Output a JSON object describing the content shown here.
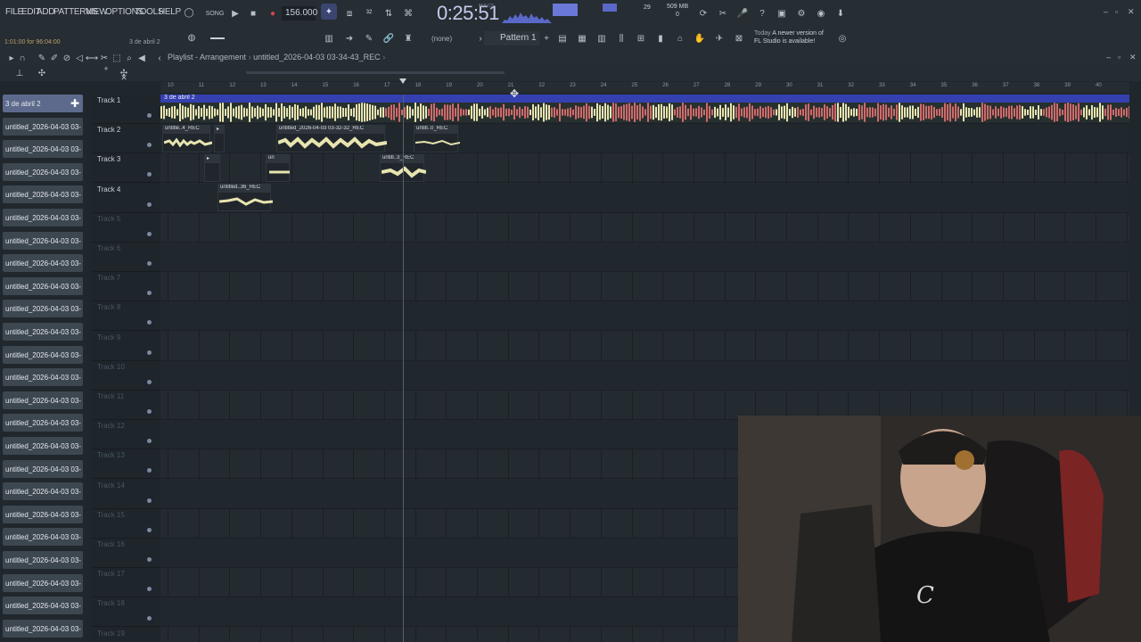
{
  "menu": {
    "items": [
      "FILE",
      "EDIT",
      "ADD",
      "PATTERNS",
      "VIEW",
      "OPTIONS",
      "TOOLS",
      "HELP"
    ]
  },
  "transport": {
    "tempo": "156.000",
    "time": "0:25:51",
    "time_unit": "M:S:CS",
    "cpu_value": "29",
    "memory": "509 MB",
    "memory_sub": "0"
  },
  "hint": {
    "position": "1:01:00 for 96:04:00",
    "track": "3 de abril 2"
  },
  "toolbar": {
    "snap": "(none)",
    "pattern": "Pattern 1"
  },
  "update_notice": {
    "line1_prefix": "Today",
    "line1": "A newer version of",
    "line2": "FL Studio is available!"
  },
  "playlist": {
    "title": "Playlist - Arrangement",
    "breadcrumb": "untitled_2026-04-03 03-34-43_REC"
  },
  "patterns": [
    {
      "label": "3 de abril 2",
      "selected": true
    },
    {
      "label": "untitled_2026-04-03 03-"
    },
    {
      "label": "untitled_2026-04-03 03-"
    },
    {
      "label": "untitled_2026-04-03 03-"
    },
    {
      "label": "untitled_2026-04-03 03-"
    },
    {
      "label": "untitled_2026-04-03 03-"
    },
    {
      "label": "untitled_2026-04-03 03-"
    },
    {
      "label": "untitled_2026-04-03 03-"
    },
    {
      "label": "untitled_2026-04-03 03-"
    },
    {
      "label": "untitled_2026-04-03 03-"
    },
    {
      "label": "untitled_2026-04-03 03-"
    },
    {
      "label": "untitled_2026-04-03 03-"
    },
    {
      "label": "untitled_2026-04-03 03-"
    },
    {
      "label": "untitled_2026-04-03 03-"
    },
    {
      "label": "untitled_2026-04-03 03-"
    },
    {
      "label": "untitled_2026-04-03 03-"
    },
    {
      "label": "untitled_2026-04-03 03-"
    },
    {
      "label": "untitled_2026-04-03 03-"
    },
    {
      "label": "untitled_2026-04-03 03-"
    },
    {
      "label": "untitled_2026-04-03 03-"
    },
    {
      "label": "untitled_2026-04-03 03-"
    },
    {
      "label": "untitled_2026-04-03 03-"
    },
    {
      "label": "untitled_2026-04-03 03-"
    },
    {
      "label": "untitled_2026-04-03 03-"
    }
  ],
  "tracks": [
    "Track 1",
    "Track 2",
    "Track 3",
    "Track 4",
    "Track 5",
    "Track 6",
    "Track 7",
    "Track 8",
    "Track 9",
    "Track 10",
    "Track 11",
    "Track 12",
    "Track 13",
    "Track 14",
    "Track 15",
    "Track 16",
    "Track 17",
    "Track 18",
    "Track 19"
  ],
  "timeline_bars": [
    "10",
    "11",
    "12",
    "13",
    "14",
    "15",
    "16",
    "17",
    "18",
    "19",
    "20",
    "21",
    "22",
    "23",
    "24",
    "25",
    "26",
    "27",
    "28",
    "29",
    "30",
    "31",
    "32",
    "33",
    "34",
    "35",
    "36",
    "37",
    "38",
    "39",
    "40"
  ],
  "clips": {
    "main": "3 de abril 2",
    "t2a": "untitle..4_REC",
    "t2b": "untitled_2026-04-03 03-32-32_REC",
    "t2c": "untitl..0_REC",
    "t3a": "un",
    "t3b": "untitl..3_REC",
    "t4a": "untitled..36_REC"
  },
  "colors": {
    "accent": "#3540b0",
    "waveform": "#e8e4b0",
    "clip_red": "#d06a6a",
    "pattern_selected": "#5e6a8c"
  }
}
